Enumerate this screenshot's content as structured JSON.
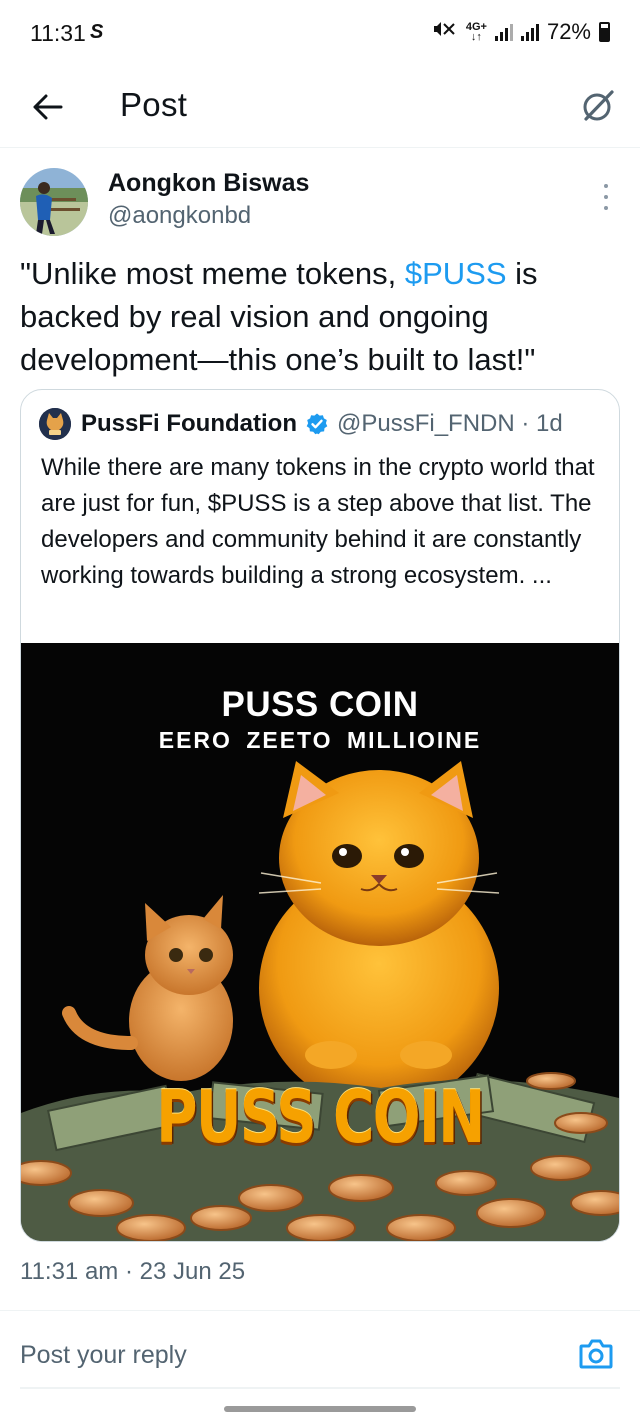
{
  "status_bar": {
    "time": "11:31",
    "network_badge_top": "4G+",
    "network_badge_bottom": "↓↑",
    "battery": "72%",
    "mute_icon": "vibrate-mute-icon",
    "s_icon": "samsung-s-icon"
  },
  "header": {
    "title": "Post",
    "back_icon": "arrow-left-icon",
    "grok_icon": "grok-icon"
  },
  "post": {
    "author_name": "Aongkon Biswas",
    "author_handle": "@aongkonbd",
    "text_before": "\"Unlike most meme tokens, ",
    "cashtag": "$PUSS",
    "text_after": " is backed by real vision and ongoing development—this one’s built to last!\"",
    "timestamp": "11:31 am · 23 Jun 25"
  },
  "quote": {
    "name": "PussFi Foundation",
    "handle": "@PussFi_FNDN · 1d",
    "text": "While there are many tokens in the crypto world that are just for fun, $PUSS is a step above that list. The developers and community behind it are constantly working towards building a strong ecosystem. ...",
    "media": {
      "title": "PUSS COIN",
      "subtitle": "EERO ZEETO MILLIOINE",
      "logo": "PUSS COIN"
    }
  },
  "reply": {
    "placeholder": "Post your reply",
    "camera_icon": "camera-icon"
  },
  "colors": {
    "accent": "#1d9bf0",
    "secondary_text": "#536471",
    "coin_gold": "#f6a100"
  }
}
